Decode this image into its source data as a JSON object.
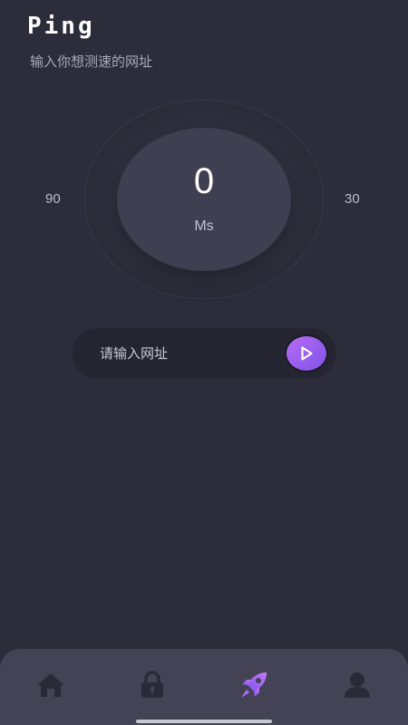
{
  "header": {
    "title": "Ping",
    "subtitle": "输入你想测速的网址"
  },
  "gauge": {
    "value": "0",
    "unit": "Ms",
    "scale_left": "90",
    "scale_right": "30"
  },
  "url_bar": {
    "placeholder": "请输入网址",
    "value": "",
    "go_icon": "play-icon",
    "accent_from": "#b86bf5",
    "accent_to": "#7e53e8"
  },
  "tab_bar": {
    "tabs": [
      {
        "icon": "home-icon",
        "active": false
      },
      {
        "icon": "lock-icon",
        "active": false
      },
      {
        "icon": "rocket-icon",
        "active": true
      },
      {
        "icon": "user-icon",
        "active": false
      }
    ],
    "inactive_color": "#2a2937",
    "active_color": "#9b5cf0"
  }
}
